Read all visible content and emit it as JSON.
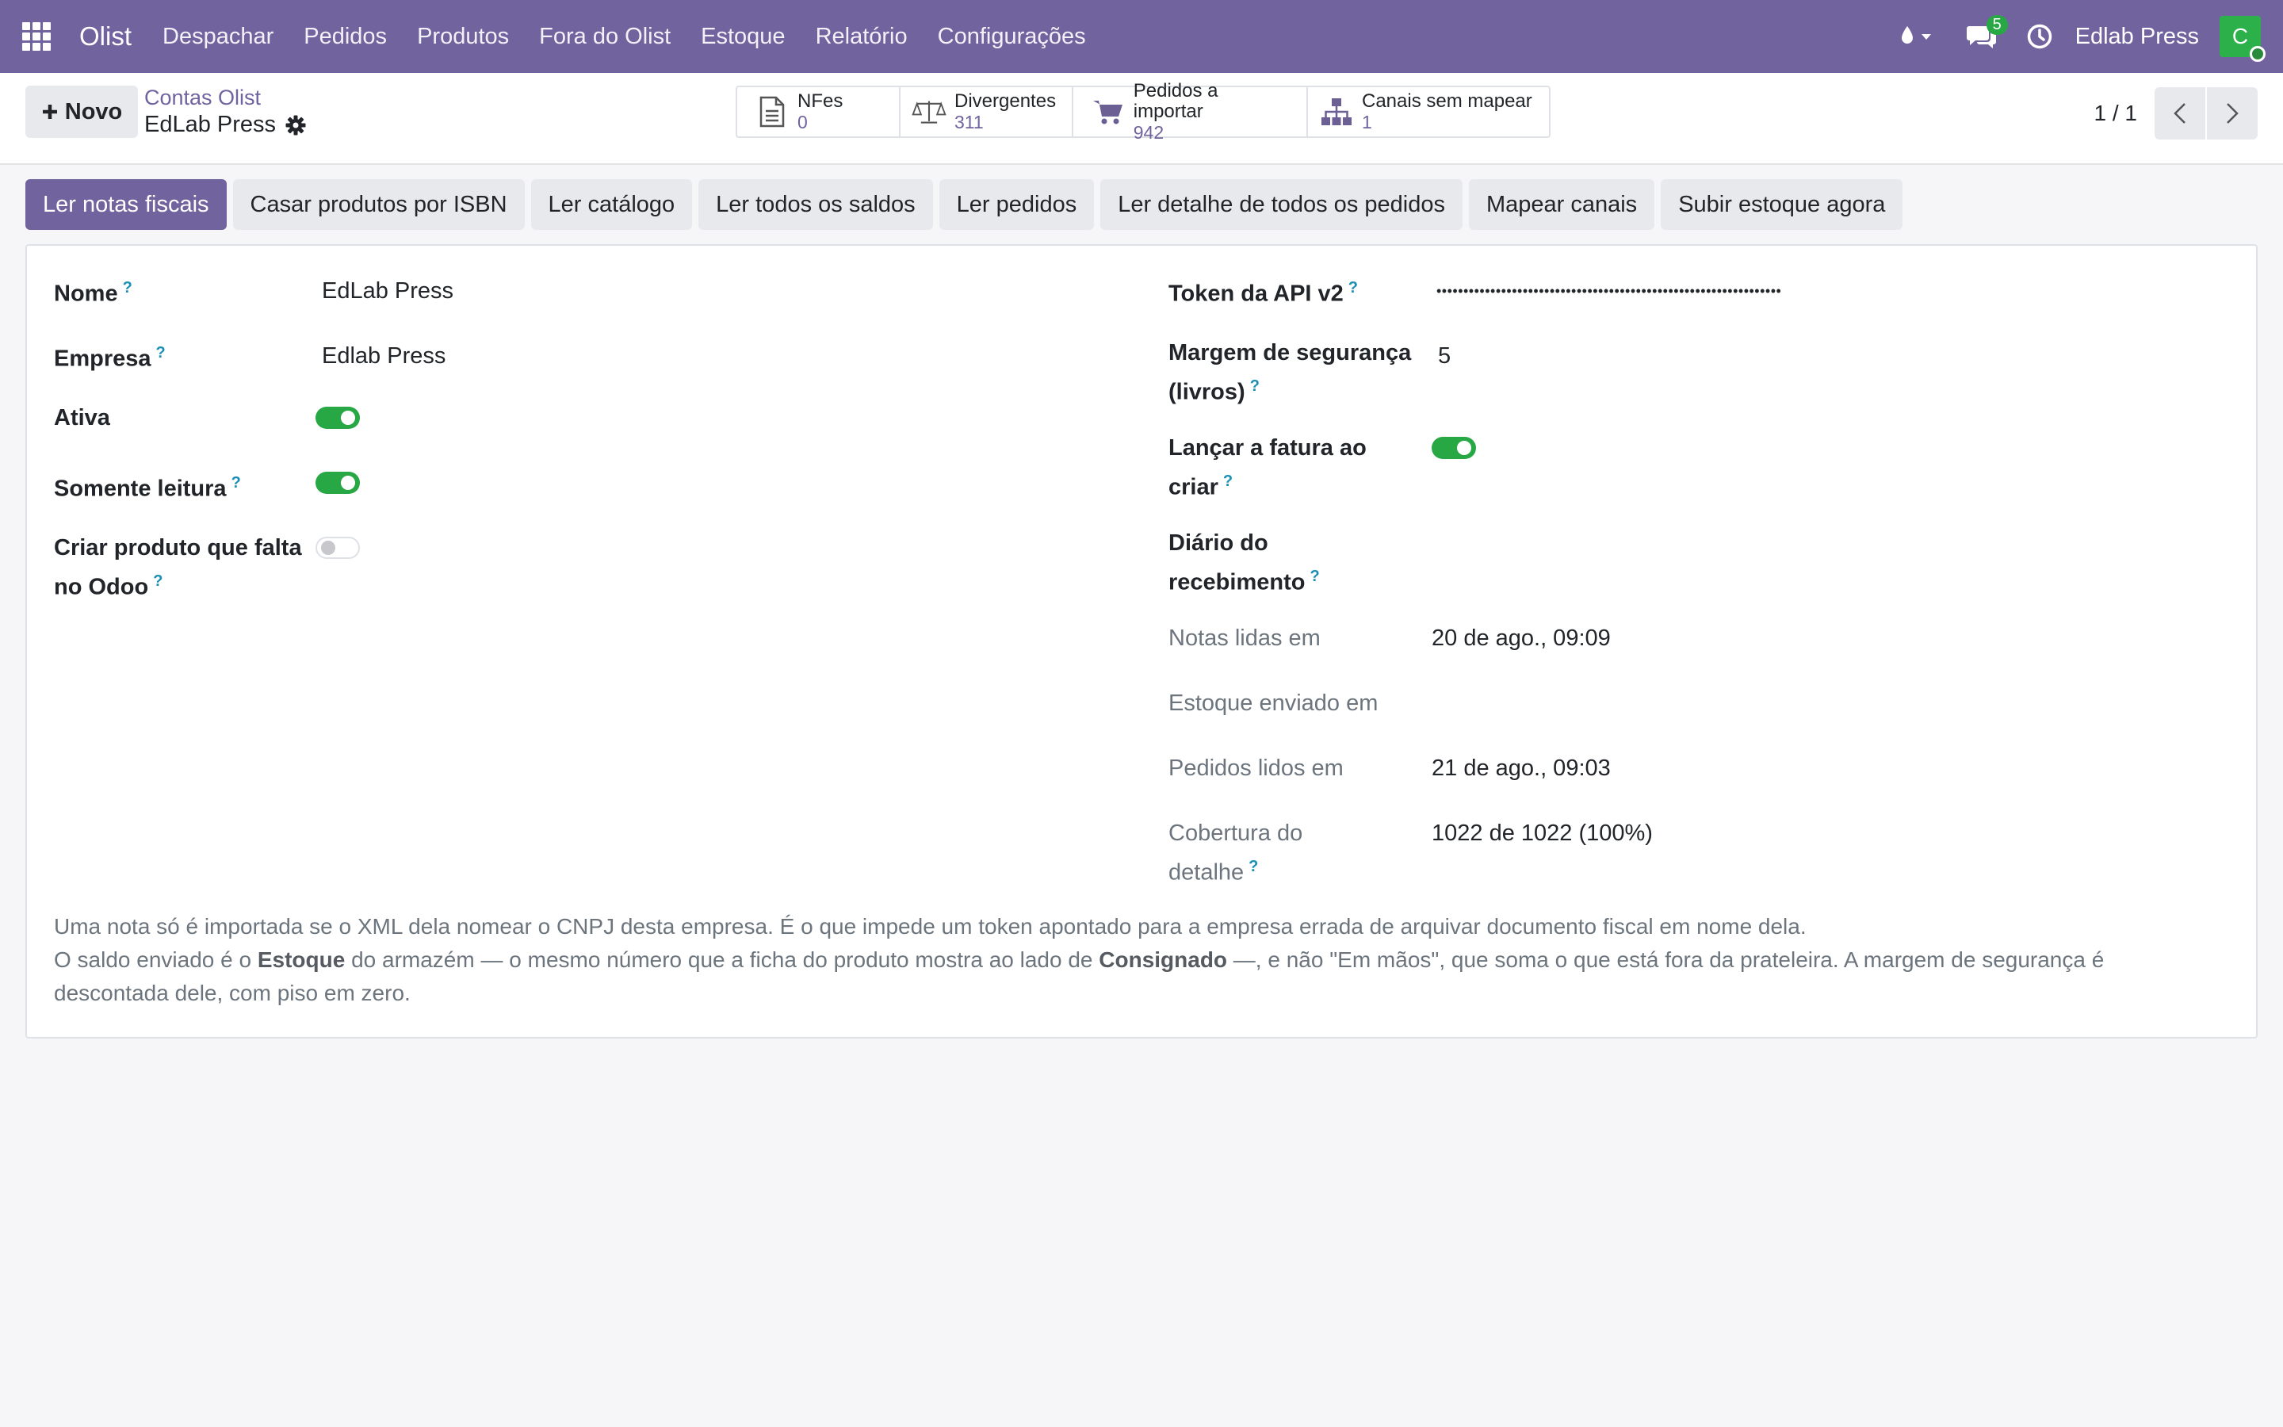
{
  "navbar": {
    "brand": "Olist",
    "menu": [
      "Despachar",
      "Pedidos",
      "Produtos",
      "Fora do Olist",
      "Estoque",
      "Relatório",
      "Configurações"
    ],
    "messages_count": "5",
    "company": "Edlab Press",
    "avatar_initial": "C"
  },
  "control_panel": {
    "new_label": "Novo",
    "breadcrumb_parent": "Contas Olist",
    "breadcrumb_current": "EdLab Press",
    "stats": [
      {
        "label": "NFes",
        "value": "0",
        "icon": "file-icon"
      },
      {
        "label": "Divergentes",
        "value": "311",
        "icon": "scale-icon"
      },
      {
        "label": "Pedidos a importar",
        "value": "942",
        "icon": "cart-icon"
      },
      {
        "label": "Canais sem mapear",
        "value": "1",
        "icon": "sitemap-icon"
      }
    ],
    "pager": "1 / 1"
  },
  "actions": [
    "Ler notas fiscais",
    "Casar produtos por ISBN",
    "Ler catálogo",
    "Ler todos os saldos",
    "Ler pedidos",
    "Ler detalhe de todos os pedidos",
    "Mapear canais",
    "Subir estoque agora"
  ],
  "form": {
    "left": {
      "nome_label": "Nome",
      "nome_value": "EdLab Press",
      "empresa_label": "Empresa",
      "empresa_value": "Edlab Press",
      "ativa_label": "Ativa",
      "ativa_value": true,
      "somente_leitura_label": "Somente leitura",
      "somente_leitura_value": true,
      "criar_produto_label_1": "Criar produto que falta",
      "criar_produto_label_2": "no Odoo",
      "criar_produto_value": false
    },
    "right": {
      "token_label": "Token da API v2",
      "token_value": "••••••••••••••••••••••••••••••••••••••••••••••••••••••••••••••••",
      "margem_label_1": "Margem de segurança",
      "margem_label_2": "(livros)",
      "margem_value": "5",
      "lancar_label_1": "Lançar a fatura ao",
      "lancar_label_2": "criar",
      "lancar_value": true,
      "diario_label_1": "Diário do",
      "diario_label_2": "recebimento",
      "notas_lidas_label": "Notas lidas em",
      "notas_lidas_value": "20 de ago., 09:09",
      "estoque_enviado_label": "Estoque enviado em",
      "pedidos_lidos_label": "Pedidos lidos em",
      "pedidos_lidos_value": "21 de ago., 09:03",
      "cobertura_label_1": "Cobertura do",
      "cobertura_label_2": "detalhe",
      "cobertura_value": "1022 de 1022 (100%)"
    },
    "help_mark": "?"
  },
  "notes": {
    "line1": "Uma nota só é importada se o XML dela nomear o CNPJ desta empresa. É o que impede um token apontado para a empresa errada de arquivar documento fiscal em nome dela.",
    "line2_a": "O saldo enviado é o ",
    "line2_b": "Estoque",
    "line2_c": " do armazém — o mesmo número que a ficha do produto mostra ao lado de ",
    "line2_d": "Consignado",
    "line2_e": " —, e não \"Em mãos\", que soma o que está fora da prateleira. A margem de segurança é",
    "line3": "descontada dele, com piso em zero."
  },
  "colors": {
    "brand": "#71639e",
    "toggle_on": "#28a745",
    "help": "#1a8fb3"
  }
}
